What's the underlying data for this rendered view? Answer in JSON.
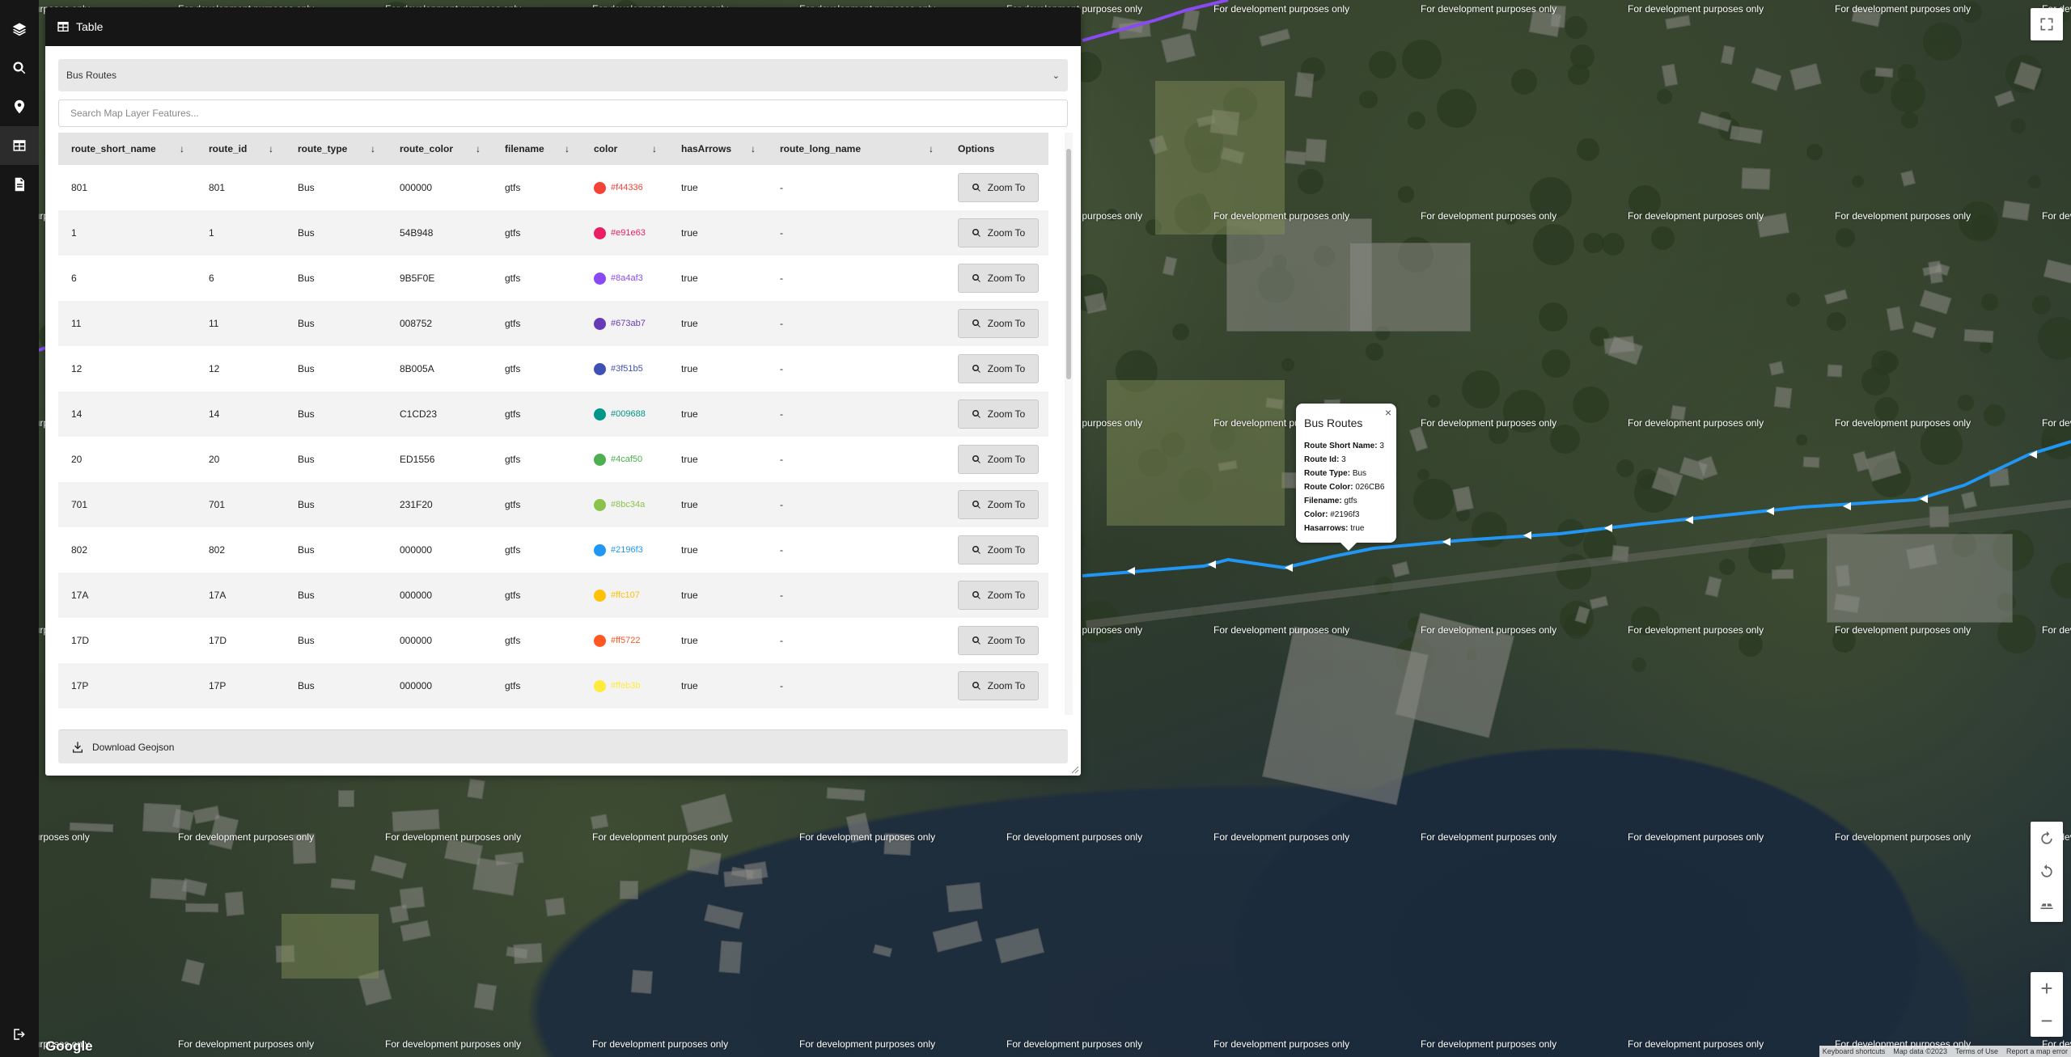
{
  "sidebar": {
    "items": [
      {
        "name": "layers",
        "icon": "layers-icon"
      },
      {
        "name": "search",
        "icon": "search-icon"
      },
      {
        "name": "location",
        "icon": "map-pin-icon"
      },
      {
        "name": "table",
        "icon": "table-icon",
        "active": true
      },
      {
        "name": "document",
        "icon": "document-icon"
      }
    ],
    "bottom_icon": "logout-icon"
  },
  "panel": {
    "title": "Table",
    "title_icon": "table-icon",
    "layer_select": "Bus Routes",
    "search_placeholder": "Search Map Layer Features...",
    "download_label": "Download Geojson",
    "columns": [
      "route_short_name",
      "route_id",
      "route_type",
      "route_color",
      "filename",
      "color",
      "hasArrows",
      "route_long_name",
      "Options"
    ],
    "rows": [
      {
        "route_short_name": "801",
        "route_id": "801",
        "route_type": "Bus",
        "route_color": "000000",
        "filename": "gtfs",
        "color": "#f44336",
        "hasArrows": "true",
        "route_long_name": "-"
      },
      {
        "route_short_name": "1",
        "route_id": "1",
        "route_type": "Bus",
        "route_color": "54B948",
        "filename": "gtfs",
        "color": "#e91e63",
        "hasArrows": "true",
        "route_long_name": "-"
      },
      {
        "route_short_name": "6",
        "route_id": "6",
        "route_type": "Bus",
        "route_color": "9B5F0E",
        "filename": "gtfs",
        "color": "#8a4af3",
        "hasArrows": "true",
        "route_long_name": "-"
      },
      {
        "route_short_name": "11",
        "route_id": "11",
        "route_type": "Bus",
        "route_color": "008752",
        "filename": "gtfs",
        "color": "#673ab7",
        "hasArrows": "true",
        "route_long_name": "-"
      },
      {
        "route_short_name": "12",
        "route_id": "12",
        "route_type": "Bus",
        "route_color": "8B005A",
        "filename": "gtfs",
        "color": "#3f51b5",
        "hasArrows": "true",
        "route_long_name": "-"
      },
      {
        "route_short_name": "14",
        "route_id": "14",
        "route_type": "Bus",
        "route_color": "C1CD23",
        "filename": "gtfs",
        "color": "#009688",
        "hasArrows": "true",
        "route_long_name": "-"
      },
      {
        "route_short_name": "20",
        "route_id": "20",
        "route_type": "Bus",
        "route_color": "ED1556",
        "filename": "gtfs",
        "color": "#4caf50",
        "hasArrows": "true",
        "route_long_name": "-"
      },
      {
        "route_short_name": "701",
        "route_id": "701",
        "route_type": "Bus",
        "route_color": "231F20",
        "filename": "gtfs",
        "color": "#8bc34a",
        "hasArrows": "true",
        "route_long_name": "-"
      },
      {
        "route_short_name": "802",
        "route_id": "802",
        "route_type": "Bus",
        "route_color": "000000",
        "filename": "gtfs",
        "color": "#2196f3",
        "hasArrows": "true",
        "route_long_name": "-"
      },
      {
        "route_short_name": "17A",
        "route_id": "17A",
        "route_type": "Bus",
        "route_color": "000000",
        "filename": "gtfs",
        "color": "#ffc107",
        "hasArrows": "true",
        "route_long_name": "-"
      },
      {
        "route_short_name": "17D",
        "route_id": "17D",
        "route_type": "Bus",
        "route_color": "000000",
        "filename": "gtfs",
        "color": "#ff5722",
        "hasArrows": "true",
        "route_long_name": "-"
      },
      {
        "route_short_name": "17P",
        "route_id": "17P",
        "route_type": "Bus",
        "route_color": "000000",
        "filename": "gtfs",
        "color": "#ffeb3b",
        "hasArrows": "true",
        "route_long_name": "-"
      }
    ],
    "zoom_label": "Zoom To"
  },
  "popup": {
    "title": "Bus Routes",
    "close_label": "×",
    "fields": [
      {
        "label": "Route Short Name:",
        "value": "3"
      },
      {
        "label": "Route Id:",
        "value": "3"
      },
      {
        "label": "Route Type:",
        "value": "Bus"
      },
      {
        "label": "Route Color:",
        "value": "026CB6"
      },
      {
        "label": "Filename:",
        "value": "gtfs"
      },
      {
        "label": "Color:",
        "value": "#2196f3"
      },
      {
        "label": "Hasarrows:",
        "value": "true"
      }
    ]
  },
  "map": {
    "watermark": "For development purposes only",
    "watermark_partial": "purposes only",
    "watermark_fragment": "For development purposes only",
    "route_color": "#2196f3",
    "google_logo": "Google",
    "attribution": [
      "Keyboard shortcuts",
      "Map data ©2023",
      "Terms of Use",
      "Report a map error"
    ],
    "zoom_in": "+",
    "zoom_out": "−"
  }
}
